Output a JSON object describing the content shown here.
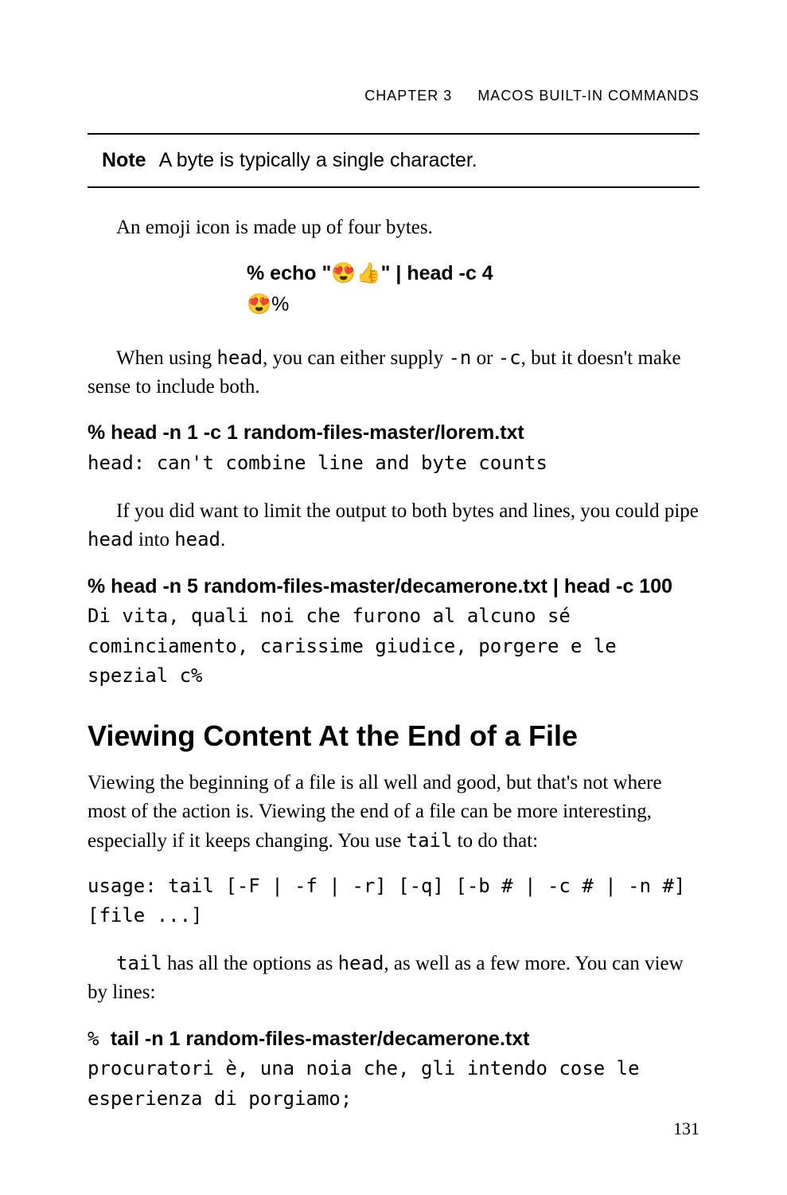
{
  "header": {
    "chapter": "CHAPTER 3",
    "title": "MACOS BUILT-IN COMMANDS"
  },
  "note": {
    "label": "Note",
    "text": "A byte is typically a single character."
  },
  "para1": "An emoji icon is made up of four bytes.",
  "code1": {
    "cmd": "% echo \"😍👍\" | head -c 4",
    "out": "😍%"
  },
  "para2_pre": "When using ",
  "para2_mono1": "head",
  "para2_mid": ", you can either supply ",
  "para2_mono2": "-n",
  "para2_or": " or ",
  "para2_mono3": "-c",
  "para2_post": ", but it doesn't make sense to include both.",
  "code2": {
    "cmd": "% head -n 1 -c 1 random-files-master/lorem.txt",
    "out": "head: can't combine line and byte counts"
  },
  "para3_pre": "If you did want to limit the output to both bytes and lines, you could pipe ",
  "para3_mono1": "head",
  "para3_mid": " into ",
  "para3_mono2": "head",
  "para3_post": ".",
  "code3": {
    "cmd": "% head -n 5 random-files-master/decamerone.txt | head -c 100",
    "out": "Di vita, quali noi che furono al alcuno sé cominciamento, carissime giudice, porgere e le spezial c%"
  },
  "section_heading": "Viewing Content At the End of a File",
  "para4_pre": "Viewing the beginning of a file is all well and good, but that's not where most of the action is. Viewing the end of a file can be more interesting, especially if it keeps changing. You use ",
  "para4_mono": "tail",
  "para4_post": " to do that:",
  "usage_line": "usage: tail [-F | -f | -r] [-q] [-b # | -c # | -n #] [file ...]",
  "para5_mono1": "tail",
  "para5_mid": " has all the options as ",
  "para5_mono2": "head",
  "para5_post": ", as well as a few more. You can view by lines:",
  "code4": {
    "prefix": "% ",
    "cmd": "tail -n 1 random-files-master/decamerone.txt",
    "out": "procuratori è, una noia che, gli intendo cose le esperienza di porgiamo;"
  },
  "page_number": "131"
}
